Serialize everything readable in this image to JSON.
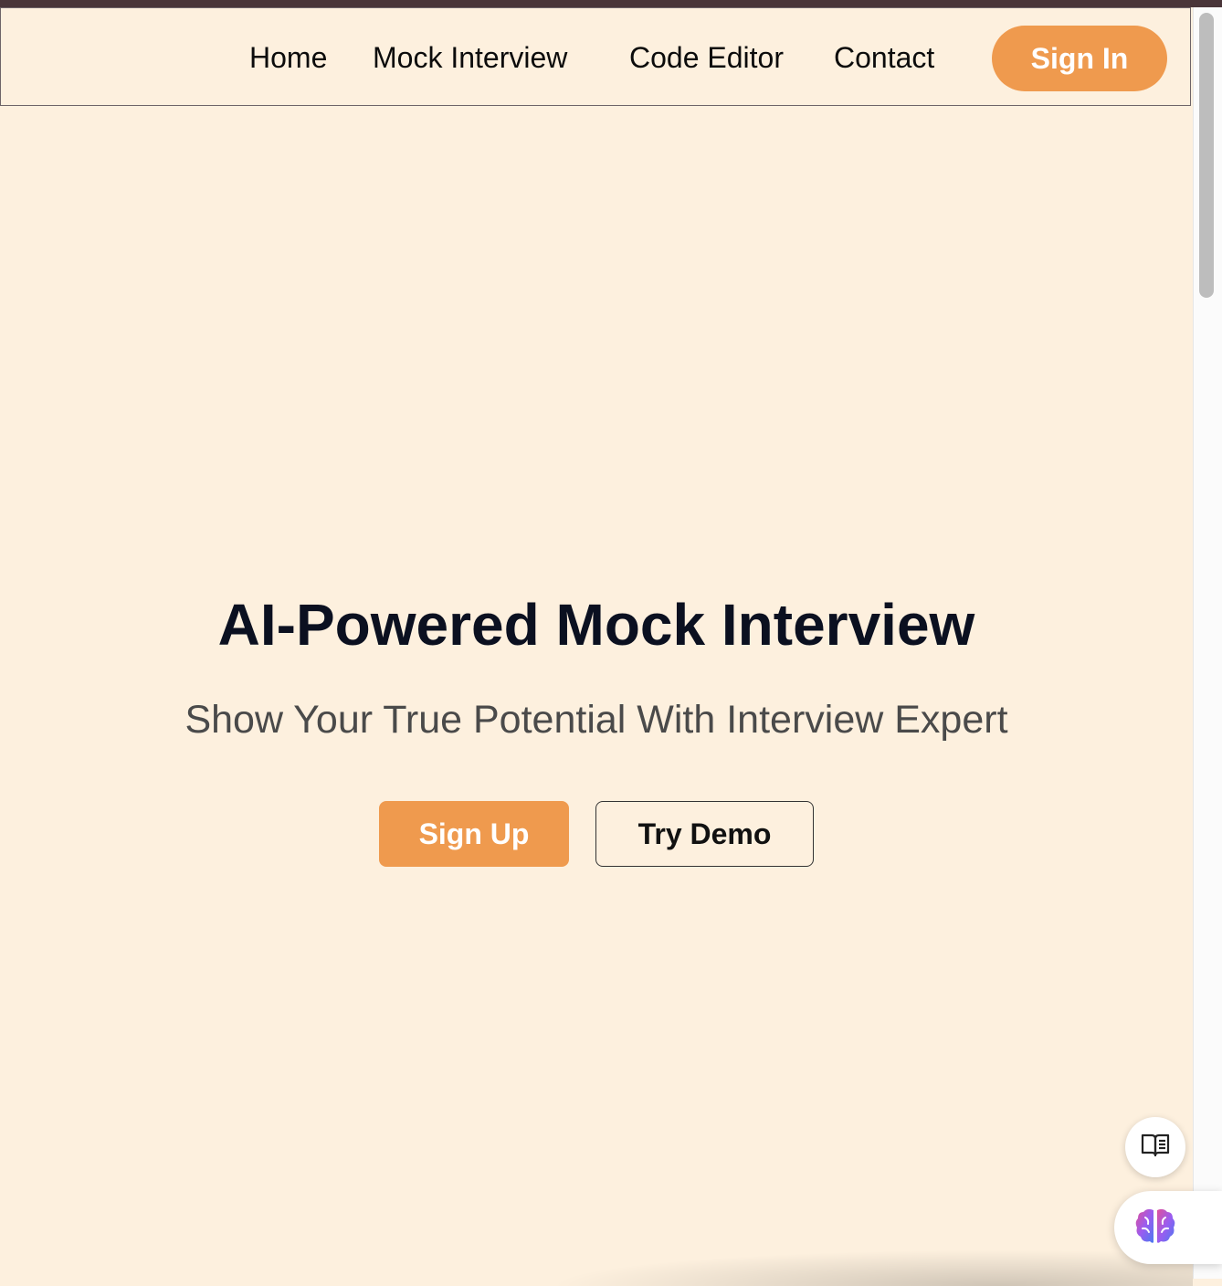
{
  "nav": {
    "links": [
      "Home",
      "Mock Interview",
      "Code Editor",
      "Contact"
    ],
    "sign_in": "Sign In"
  },
  "hero": {
    "title": "AI-Powered Mock Interview",
    "subtitle": "Show Your True Potential With Interview Expert",
    "signup": "Sign Up",
    "demo": "Try Demo"
  },
  "floating": {
    "reader_icon": "book-open-icon",
    "assistant_icon": "brain-icon"
  },
  "colors": {
    "background": "#fdf0de",
    "accent": "#ef9a4e",
    "title": "#0b1020",
    "topstrip": "#4a3539"
  }
}
